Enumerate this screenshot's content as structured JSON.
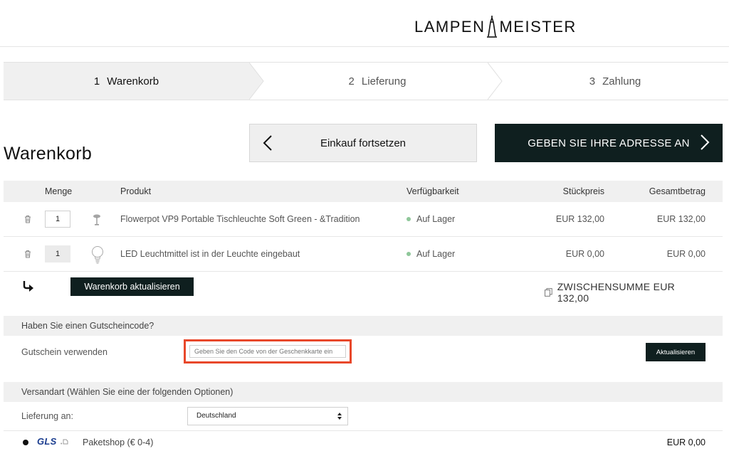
{
  "brand": {
    "logo_left": "LAMPEN",
    "logo_right": "MEISTER"
  },
  "steps": [
    {
      "num": "1",
      "label": "Warenkorb",
      "active": true
    },
    {
      "num": "2",
      "label": "Lieferung",
      "active": false
    },
    {
      "num": "3",
      "label": "Zahlung",
      "active": false
    }
  ],
  "page_title": "Warenkorb",
  "actions": {
    "continue_label": "Einkauf fortsetzen",
    "address_label": "GEBEN SIE IHRE ADRESSE AN"
  },
  "table": {
    "headers": {
      "qty": "Menge",
      "product": "Produkt",
      "availability": "Verfügbarkeit",
      "unit_price": "Stückpreis",
      "total": "Gesamtbetrag"
    },
    "rows": [
      {
        "qty": "1",
        "name": "Flowerpot VP9 Portable Tischleuchte Soft Green - &Tradition",
        "availability": "Auf Lager",
        "unit_price": "EUR 132,00",
        "total": "EUR 132,00"
      },
      {
        "qty": "1",
        "name": "LED Leuchtmittel ist in der Leuchte eingebaut",
        "availability": "Auf Lager",
        "unit_price": "EUR 0,00",
        "total": "EUR 0,00"
      }
    ],
    "update_label": "Warenkorb aktualisieren",
    "subtotal_label": "ZWISCHENSUMME EUR 132,00"
  },
  "voucher": {
    "heading": "Haben Sie einen Gutscheincode?",
    "label": "Gutschein verwenden",
    "placeholder": "Geben Sie den Code von der Geschenkkarte ein",
    "apply_label": "Aktualisieren"
  },
  "shipping": {
    "heading": "Versandart (Wählen Sie eine der folgenden Optionen)",
    "deliver_to_label": "Lieferung an:",
    "country": "Deutschland",
    "carrier": "GLS",
    "option_name": "Paketshop (€ 0-4)",
    "option_price": "EUR 0,00"
  },
  "colors": {
    "dark_button": "#0f1f1f",
    "highlight": "#e8472a",
    "in_stock": "#8fc79a",
    "gls_blue": "#1b3d8f"
  }
}
